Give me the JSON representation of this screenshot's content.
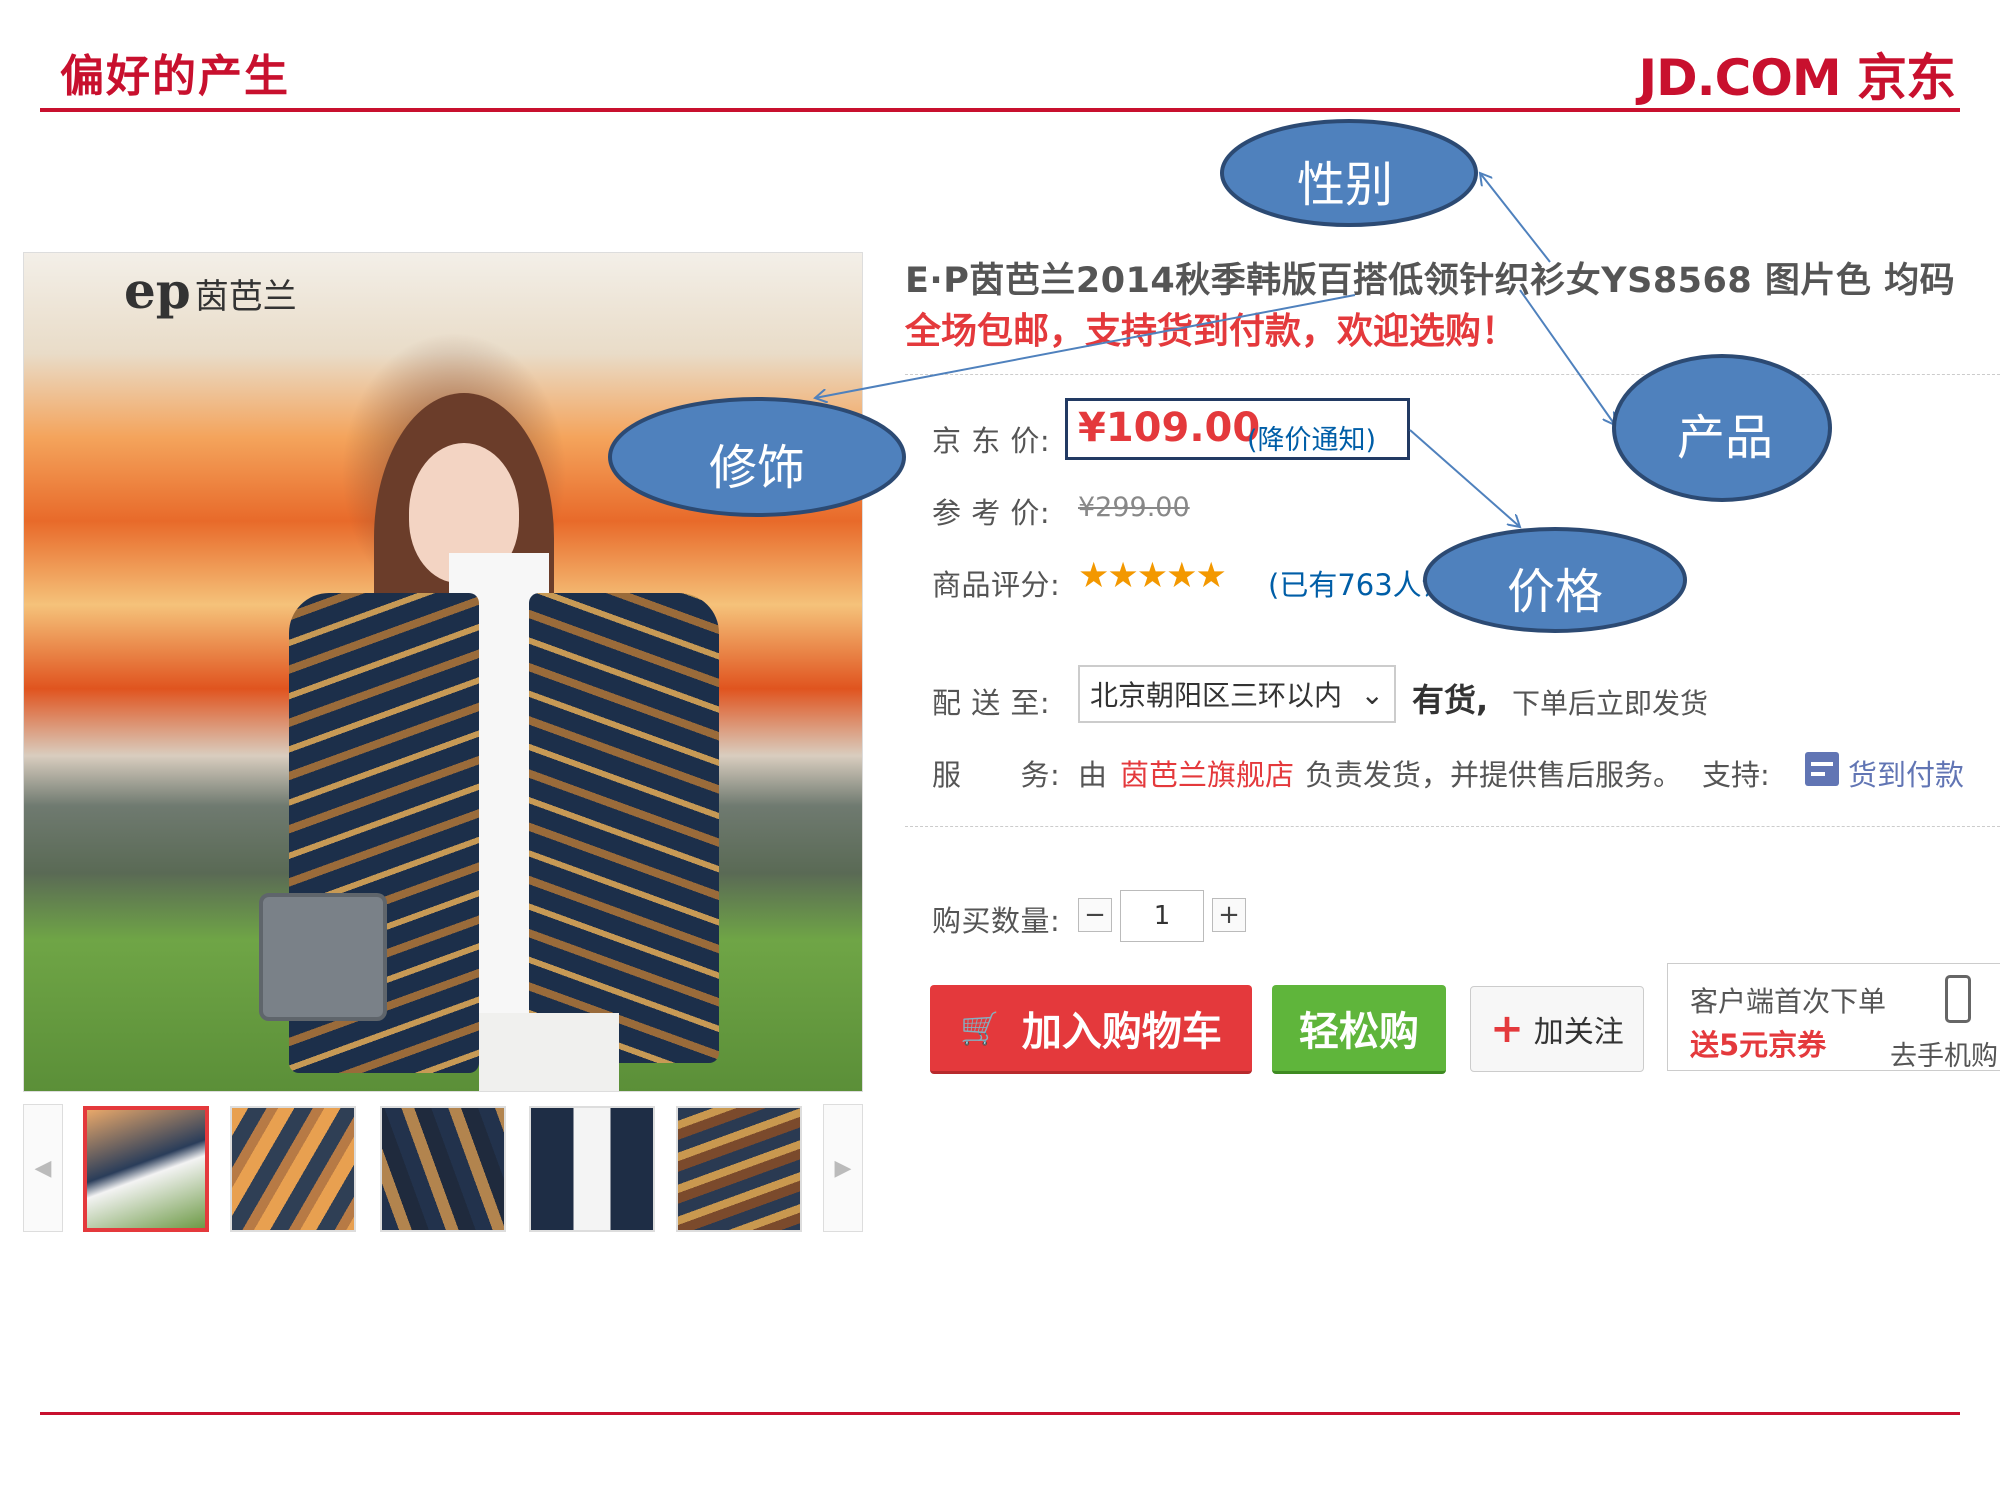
{
  "slide": {
    "title": "偏好的产生",
    "brand": "JD.COM 京东"
  },
  "gallery": {
    "logo_mark": "ep",
    "logo_text": "茵芭兰",
    "prev_arrow": "◀",
    "next_arrow": "▶",
    "thumbnail_count": 5,
    "selected_index": 0
  },
  "product": {
    "title": "E·P茵芭兰2014秋季韩版百搭低领针织衫女YS8568 图片色 均码",
    "promo": "全场包邮，支持货到付款，欢迎选购！",
    "jd_price_label": "京 东 价:",
    "jd_price": "¥109.00",
    "price_alert": "(降价通知)",
    "ref_price_label": "参 考 价:",
    "ref_price": "¥299.00",
    "rating_label": "商品评分:",
    "rating_stars": 5,
    "rating_glyphs": "★★★★★",
    "review_count": "(已有763人评",
    "ship_to_label": "配 送 至:",
    "region": "北京朝阳区三环以内",
    "stock_status": "有货,",
    "stock_note": "下单后立即发货",
    "service_label": "服　　务:",
    "service_pre": "由",
    "shop_name": "茵芭兰旗舰店",
    "service_post": "负责发货，并提供售后服务。",
    "support_label": "支持:",
    "cod_label": "货到付款",
    "qty_label": "购买数量:",
    "qty_minus": "−",
    "qty_plus": "+",
    "qty_value": "1",
    "add_to_cart": "加入购物车",
    "cart_icon": "cart-icon",
    "easy_buy": "轻松购",
    "follow": "加关注",
    "mobile_first_order": "客户端首次下单",
    "mobile_coupon": "送5元京券",
    "mobile_buy": "去手机购"
  },
  "annotations": {
    "gender": "性别",
    "decor": "修饰",
    "product": "产品",
    "price": "价格",
    "bubble_fill": "#4f81bd",
    "bubble_stroke": "#2c4a73"
  },
  "colors": {
    "accent": "#c8102e",
    "price_red": "#e4393c",
    "link_blue": "#005ea7",
    "buy_green": "#5fb53b"
  }
}
